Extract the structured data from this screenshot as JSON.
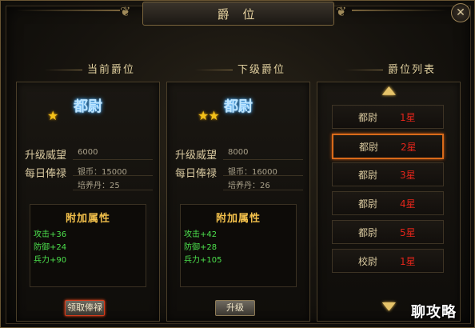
{
  "window": {
    "title": "爵 位",
    "close_glyph": "✕"
  },
  "sections": {
    "current": "当前爵位",
    "next": "下级爵位",
    "list": "爵位列表"
  },
  "labels": {
    "upgrade_prestige": "升级威望",
    "daily_salary": "每日俸禄",
    "bonus_title": "附加属性"
  },
  "current": {
    "rank": "都尉",
    "stars": "★",
    "prestige": "6000",
    "silver": "银币：15000",
    "pill": "培养丹：25",
    "bonus": [
      "攻击+36",
      "防御+24",
      "兵力+90"
    ],
    "button": "领取俸禄"
  },
  "next": {
    "rank": "都尉",
    "stars": "★★",
    "prestige": "8000",
    "silver": "银币：16000",
    "pill": "培养丹：26",
    "bonus": [
      "攻击+42",
      "防御+28",
      "兵力+105"
    ],
    "button": "升级"
  },
  "rank_list": [
    {
      "rank": "都尉",
      "star": "1星"
    },
    {
      "rank": "都尉",
      "star": "2星"
    },
    {
      "rank": "都尉",
      "star": "3星"
    },
    {
      "rank": "都尉",
      "star": "4星"
    },
    {
      "rank": "都尉",
      "star": "5星"
    },
    {
      "rank": "校尉",
      "star": "1星"
    }
  ],
  "selected_index": 1,
  "watermark": "聊攻略",
  "colors": {
    "accent": "#d96a1a",
    "star_red": "#e1251a",
    "bonus_green": "#4ce04c",
    "gold": "#f2c04b"
  }
}
